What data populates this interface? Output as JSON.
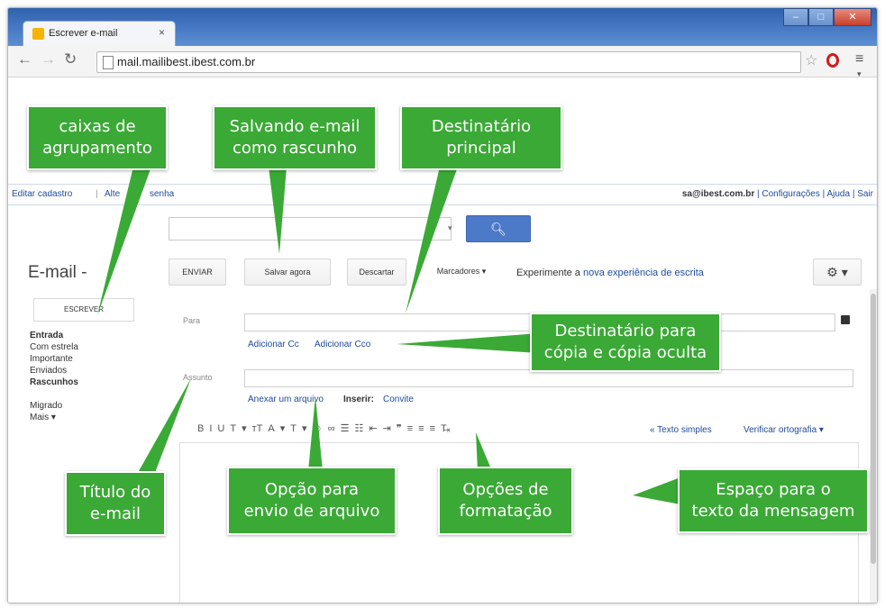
{
  "browser": {
    "tab_title": "Escrever e-mail",
    "tab_close": "×",
    "url": "mail.mailibest.ibest.com.br"
  },
  "topbar": {
    "edit_profile": "Editar cadastro",
    "separator": "|",
    "change_password_partial": "Alte",
    "change_password_tail": "senha",
    "user_email": "sa@ibest.com.br",
    "settings": "Configurações",
    "help": "Ajuda",
    "logout": "Sair"
  },
  "sidebar": {
    "title": "E-mail -",
    "compose": "ESCREVER",
    "folders": [
      {
        "label": "Entrada",
        "bold": true
      },
      {
        "label": "Com estrela",
        "bold": false
      },
      {
        "label": "Importante",
        "bold": false
      },
      {
        "label": "Enviados",
        "bold": false
      },
      {
        "label": "Rascunhos",
        "bold": true
      },
      {
        "label": "",
        "bold": false
      },
      {
        "label": "Migrado",
        "bold": false
      },
      {
        "label": "Mais ▾",
        "bold": false
      }
    ]
  },
  "toolbar": {
    "send": "ENVIAR",
    "save_now": "Salvar agora",
    "discard": "Descartar",
    "labels": "Marcadores ▾",
    "experiment_prefix": "Experimente a",
    "experiment_link": "nova experiência de escrita",
    "settings_icon": "gear-icon"
  },
  "compose": {
    "to_label": "Para",
    "add_cc": "Adicionar Cc",
    "add_bcc": "Adicionar Cco",
    "subject_label": "Assunto",
    "attach_file": "Anexar um arquivo",
    "insert_label": "Inserir:",
    "invite": "Convite",
    "format_buttons": [
      "B",
      "I",
      "U",
      "T",
      "▾",
      "тT",
      "A",
      "▾",
      "T",
      "▾",
      "☺",
      "∞",
      "☰",
      "☷",
      "⇤",
      "⇥",
      "❞",
      "≡",
      "≡",
      "≡",
      "T̶ₓ"
    ],
    "plain_text": "« Texto simples",
    "spell_check": "Verificar ortografia ▾"
  },
  "callouts": {
    "grouping_boxes": [
      "caixas de",
      "agrupamento"
    ],
    "save_draft": [
      "Salvando e-mail",
      "como rascunho"
    ],
    "main_recipient": [
      "Destinatário",
      "principal"
    ],
    "cc_bcc": [
      "Destinatário para",
      "cópia e cópia oculta"
    ],
    "subject_title": [
      "Título do",
      "e-mail"
    ],
    "attach_option": [
      "Opção para",
      "envio de arquivo"
    ],
    "format_options": [
      "Opções de",
      "formatação"
    ],
    "message_space": [
      "Espaço para o",
      "texto da mensagem"
    ]
  },
  "colors": {
    "callout_green": "#3aa935",
    "link_blue": "#1f4a9a",
    "search_button": "#4d79c9"
  }
}
